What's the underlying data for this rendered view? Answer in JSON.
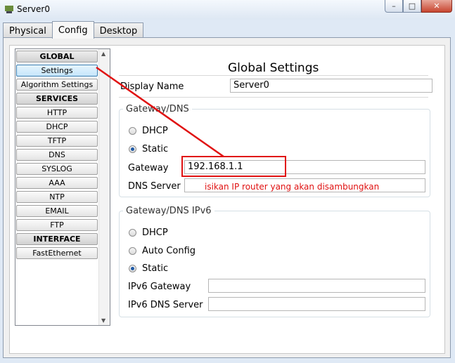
{
  "window": {
    "title": "Server0",
    "minimize": "–",
    "maximize": "□",
    "close": "✕"
  },
  "tabs": [
    {
      "label": "Physical"
    },
    {
      "label": "Config"
    },
    {
      "label": "Desktop"
    }
  ],
  "sidebar": {
    "items": [
      {
        "label": "GLOBAL"
      },
      {
        "label": "Settings"
      },
      {
        "label": "Algorithm Settings"
      },
      {
        "label": "SERVICES"
      },
      {
        "label": "HTTP"
      },
      {
        "label": "DHCP"
      },
      {
        "label": "TFTP"
      },
      {
        "label": "DNS"
      },
      {
        "label": "SYSLOG"
      },
      {
        "label": "AAA"
      },
      {
        "label": "NTP"
      },
      {
        "label": "EMAIL"
      },
      {
        "label": "FTP"
      },
      {
        "label": "INTERFACE"
      },
      {
        "label": "FastEthernet"
      }
    ]
  },
  "main": {
    "heading": "Global Settings",
    "display_name_label": "Display Name",
    "display_name_value": "Server0",
    "ipv4": {
      "legend": "Gateway/DNS",
      "dhcp_label": "DHCP",
      "static_label": "Static",
      "selected": "Static",
      "gateway_label": "Gateway",
      "gateway_value": "192.168.1.1",
      "dns_label": "DNS Server",
      "dns_value": ""
    },
    "ipv6": {
      "legend": "Gateway/DNS IPv6",
      "dhcp_label": "DHCP",
      "auto_label": "Auto Config",
      "static_label": "Static",
      "selected": "Static",
      "gateway_label": "IPv6 Gateway",
      "gateway_value": "",
      "dns_label": "IPv6 DNS Server",
      "dns_value": ""
    }
  },
  "annotation": {
    "text": "isikan IP router yang akan disambungkan",
    "color": "#e01010"
  }
}
